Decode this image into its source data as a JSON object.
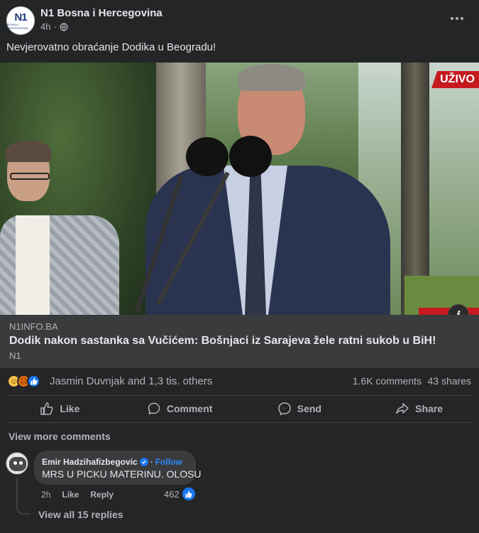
{
  "post": {
    "page_name": "N1 Bosna i Hercegovina",
    "time": "4h",
    "separator": "·",
    "text": "Nevjerovatno obraćanje Dodika u Beogradu!",
    "avatar_logo": "N1",
    "avatar_sub": "BOSNA I HERCEGOVINA"
  },
  "video": {
    "live_label": "UŽIVO",
    "info_label": "i"
  },
  "link": {
    "domain": "N1INFO.BA",
    "title": "Dodik nakon sastanka sa Vučićem: Bošnjaci iz Sarajeva žele ratni sukob u BiH!",
    "source": "N1"
  },
  "stats": {
    "reactions": [
      "haha",
      "angry",
      "like"
    ],
    "reaction_names": "Jasmin Duvnjak and 1,3 tis. others",
    "comments": "1.6K comments",
    "shares": "43 shares"
  },
  "actions": [
    {
      "label": "Like",
      "icon": "thumbs-up-icon"
    },
    {
      "label": "Comment",
      "icon": "comment-bubble-icon"
    },
    {
      "label": "Send",
      "icon": "messenger-icon"
    },
    {
      "label": "Share",
      "icon": "share-arrow-icon"
    }
  ],
  "comments": {
    "view_more": "View more comments",
    "items": [
      {
        "author": "Emir Hadzihafizbegovic",
        "follow": "Follow",
        "separator": "·",
        "text": "MRS U PICKU MATERINU. OLOSU",
        "time": "2h",
        "like_label": "Like",
        "reply_label": "Reply",
        "likes": "462",
        "view_replies": "View all 15 replies"
      }
    ]
  },
  "colors": {
    "background": "#242526",
    "link_box": "#3a3b3c",
    "live_red": "#c51a1f",
    "facebook_blue": "#1877f2",
    "muted_text": "#b0b3b8"
  }
}
